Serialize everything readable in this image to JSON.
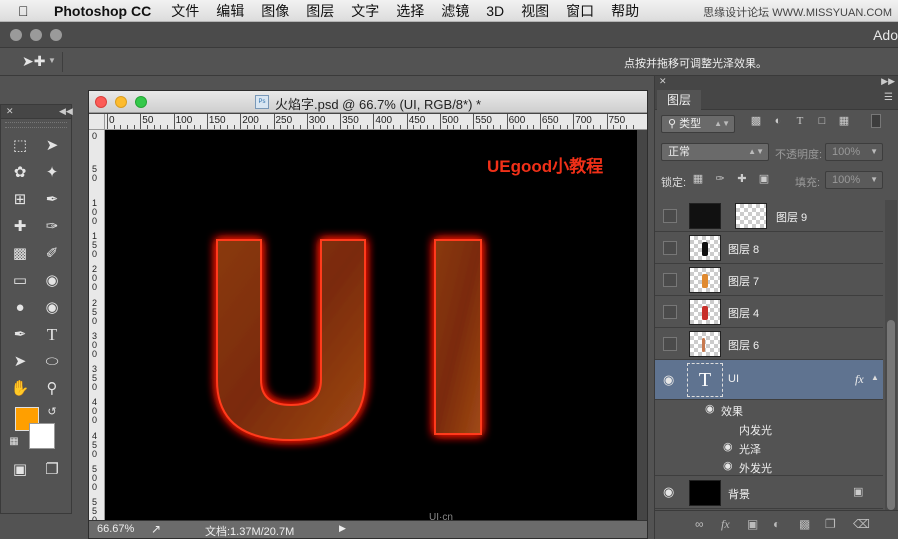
{
  "menubar": {
    "app_name": "Photoshop CC",
    "items": [
      "文件",
      "编辑",
      "图像",
      "图层",
      "文字",
      "选择",
      "滤镜",
      "3D",
      "视图",
      "窗口",
      "帮助"
    ],
    "watermark": "思缘设计论坛 WWW.MISSYUAN.COM"
  },
  "titlebar": {
    "app_label": "Ado"
  },
  "options_bar": {
    "hint": "点按并拖移可调整光泽效果。"
  },
  "toolbox": {
    "foreground_color": "#ff9f00",
    "background_color": "#ffffff",
    "tools": [
      "marquee-icon",
      "move-icon",
      "lasso-icon",
      "magic-wand-icon",
      "crop-icon",
      "eyedropper-icon",
      "healing-brush-icon",
      "brush-icon",
      "stamp-icon",
      "history-brush-icon",
      "eraser-icon",
      "paint-bucket-icon",
      "blur-icon",
      "dodge-icon",
      "pen-icon",
      "type-icon",
      "path-select-icon",
      "ellipse-icon",
      "hand-icon",
      "zoom-icon"
    ]
  },
  "document": {
    "title": "火焰字.psd @ 66.7% (UI, RGB/8*) *",
    "ruler_h": [
      "0",
      "50",
      "100",
      "150",
      "200",
      "250",
      "300",
      "350",
      "400",
      "450",
      "500",
      "550",
      "600",
      "650",
      "700",
      "750"
    ],
    "ruler_v": [
      "0",
      "5\n0",
      "1\n0\n0",
      "1\n5\n0",
      "2\n0\n0",
      "2\n5\n0",
      "3\n0\n0",
      "3\n5\n0",
      "4\n0\n0",
      "4\n5\n0",
      "5\n0\n0",
      "5\n5\n0"
    ],
    "canvas_label": "UEgood小教程",
    "canvas_text": "UI",
    "canvas_watermark": "UI·cn",
    "zoom": "66.67%",
    "doc_size": "文档:1.37M/20.7M"
  },
  "layers_panel": {
    "tab": "图层",
    "filter_kind": "类型",
    "blend_mode": "正常",
    "opacity_label": "不透明度:",
    "opacity_value": "100%",
    "lock_label": "锁定:",
    "fill_label": "填充:",
    "fill_value": "100%",
    "layers": [
      {
        "name": "图层 9",
        "visible": false
      },
      {
        "name": "图层 8",
        "visible": false
      },
      {
        "name": "图层 7",
        "visible": false
      },
      {
        "name": "图层 4",
        "visible": false
      },
      {
        "name": "图层 6",
        "visible": false
      },
      {
        "name": "UI",
        "visible": true,
        "selected": true
      }
    ],
    "type_thumb": "T",
    "fx_badge": "fx",
    "effects_label": "效果",
    "effects": [
      {
        "name": "内发光",
        "visible": false
      },
      {
        "name": "光泽",
        "visible": true
      },
      {
        "name": "外发光",
        "visible": true
      }
    ],
    "background_layer": "背景"
  }
}
